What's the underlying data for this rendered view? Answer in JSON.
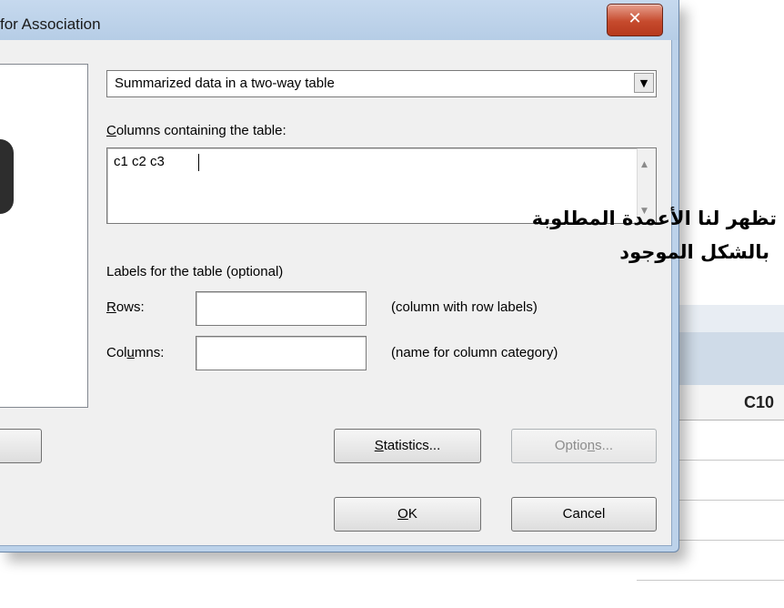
{
  "window": {
    "title": "for Association",
    "close_glyph": "✕"
  },
  "data_source": {
    "selected": "Summarized data in a two-way table"
  },
  "columns": {
    "label_prefix": "",
    "label_mnemonic": "C",
    "label_rest": "olumns containing the table:",
    "value": "c1 c2 c3"
  },
  "labels_section": {
    "heading": "Labels for the table (optional)",
    "rows_label_mnemonic": "R",
    "rows_label_rest": "ows:",
    "rows_value": "",
    "rows_hint": "(column with row labels)",
    "columns_label_pre": "Col",
    "columns_label_mnemonic": "u",
    "columns_label_post": "mns:",
    "columns_value": "",
    "columns_hint": "(name for column category)"
  },
  "buttons": {
    "statistics_mnemonic": "S",
    "statistics_rest": "tatistics...",
    "options_pre": "Optio",
    "options_mnemonic": "n",
    "options_post": "s...",
    "ok_mnemonic": "O",
    "ok_rest": "K",
    "cancel": "Cancel"
  },
  "background_sheet": {
    "column_header": "C10"
  },
  "annotation": {
    "line1": "تظهر لنا الأعمدة المطلوبة",
    "line2": "بالشكل الموجود"
  },
  "colors": {
    "window_frame": "#bcd2ea",
    "close_button": "#c64a2d",
    "dialog_face": "#f0f0f0"
  }
}
